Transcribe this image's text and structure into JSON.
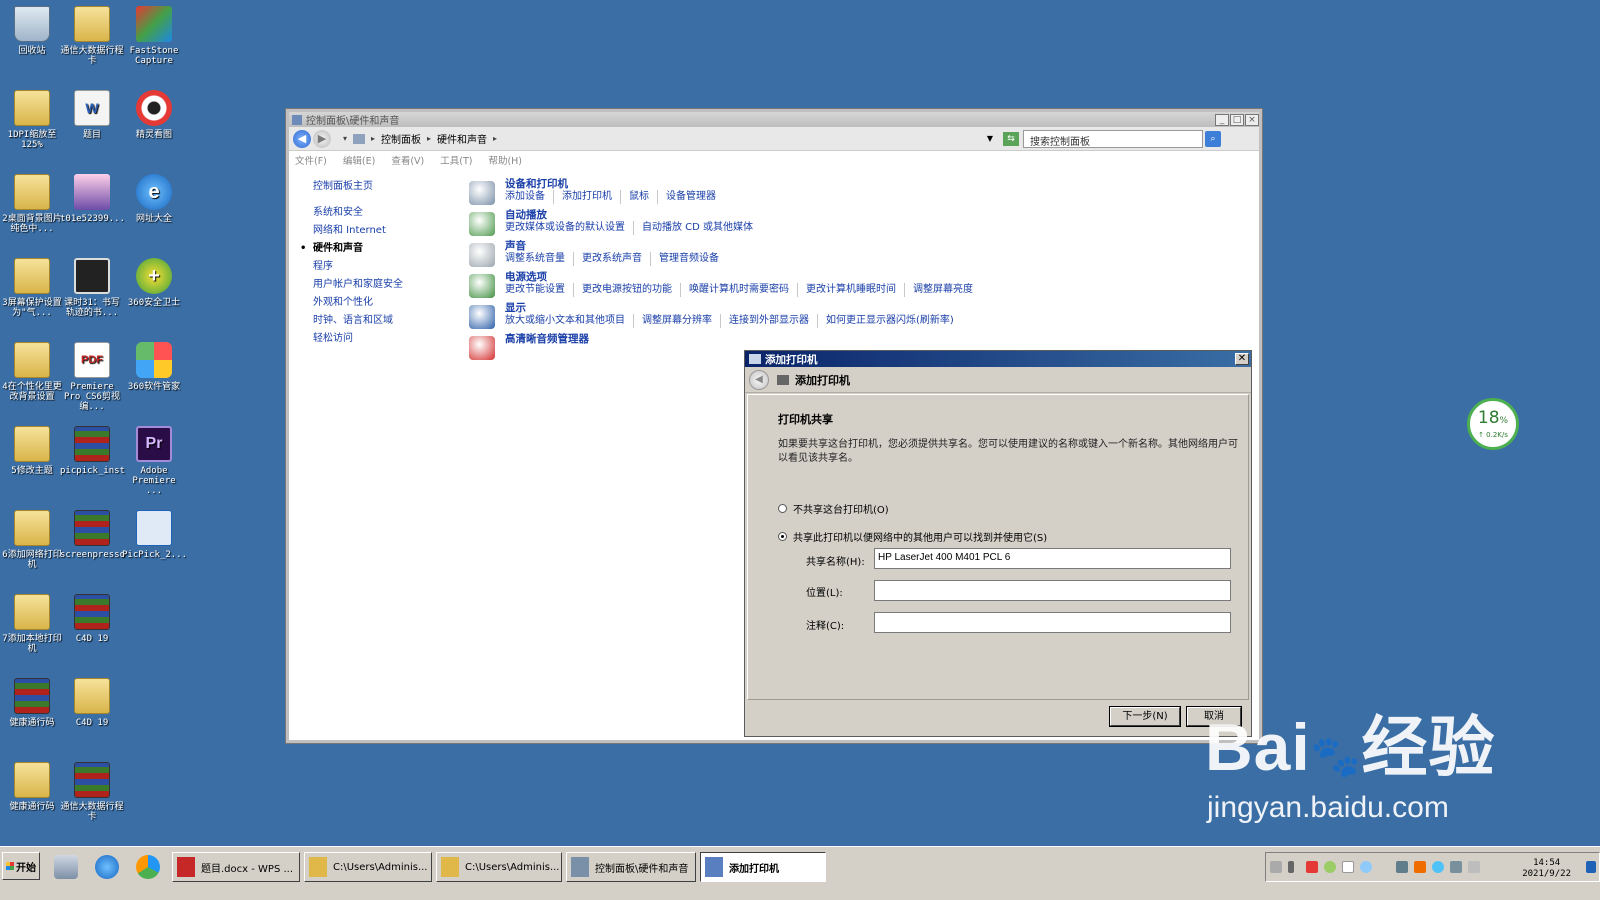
{
  "desktop": {
    "icons": [
      {
        "label": "回收站",
        "kind": "recycle"
      },
      {
        "label": "通信大数据行程卡",
        "kind": "folder"
      },
      {
        "label": "FastStone Capture",
        "kind": "app"
      },
      {
        "label": "1DPI缩放至125%",
        "kind": "folder"
      },
      {
        "label": "题目",
        "kind": "doc"
      },
      {
        "label": "精灵看图",
        "kind": "eye"
      },
      {
        "label": "2桌面背景图片纯色中...",
        "kind": "folder"
      },
      {
        "label": "t01e52399...",
        "kind": "pic"
      },
      {
        "label": "网址大全",
        "kind": "ie"
      },
      {
        "label": "3屏幕保护设置为\"气...",
        "kind": "folder"
      },
      {
        "label": "课时31：书写轨迹的书...",
        "kind": "dark"
      },
      {
        "label": "360安全卫士",
        "kind": "green"
      },
      {
        "label": "4在个性化里更改背景设置",
        "kind": "folder"
      },
      {
        "label": "Premiere Pro CS6剪视编...",
        "kind": "pdf"
      },
      {
        "label": "360软件管家",
        "kind": "color4"
      },
      {
        "label": "5修改主题",
        "kind": "folder"
      },
      {
        "label": "picpick_inst",
        "kind": "rar"
      },
      {
        "label": "Adobe Premiere ...",
        "kind": "pr"
      },
      {
        "label": "6添加网络打印机",
        "kind": "folder"
      },
      {
        "label": "screenpresso",
        "kind": "rar"
      },
      {
        "label": "PicPick_2...",
        "kind": "screen"
      },
      {
        "label": "7添加本地打印机",
        "kind": "folder"
      },
      {
        "label": "C4D 19",
        "kind": "rar"
      },
      {
        "label": "C4D 19",
        "kind": "folder"
      },
      {
        "label": "健康通行码",
        "kind": "rar"
      },
      {
        "label": "健康通行码",
        "kind": "folder"
      },
      {
        "label": "通信大数据行程卡",
        "kind": "rar"
      }
    ],
    "glyphs": {
      "pdf": "PDF",
      "pr": "Pr",
      "ie": "e",
      "green": "+",
      "doc": "W"
    }
  },
  "control_panel": {
    "title": "控制面板\\硬件和声音",
    "breadcrumb": [
      "控制面板",
      "硬件和声音"
    ],
    "search_placeholder": "搜索控制面板",
    "menu": [
      "文件(F)",
      "编辑(E)",
      "查看(V)",
      "工具(T)",
      "帮助(H)"
    ],
    "left_nav": {
      "home": "控制面板主页",
      "items": [
        "系统和安全",
        "网络和 Internet",
        "硬件和声音",
        "程序",
        "用户帐户和家庭安全",
        "外观和个性化",
        "时钟、语言和区域",
        "轻松访问"
      ],
      "current_index": 2
    },
    "categories": [
      {
        "title": "设备和打印机",
        "links": [
          "添加设备",
          "添加打印机",
          "鼠标",
          "设备管理器"
        ],
        "icon": "printer-icon",
        "color": "#7a8fa8"
      },
      {
        "title": "自动播放",
        "links": [
          "更改媒体或设备的默认设置",
          "自动播放 CD 或其他媒体"
        ],
        "icon": "autoplay-icon",
        "color": "#4e9a4e"
      },
      {
        "title": "声音",
        "links": [
          "调整系统音量",
          "更改系统声音",
          "管理音频设备"
        ],
        "icon": "speaker-icon",
        "color": "#9aa4ad"
      },
      {
        "title": "电源选项",
        "links": [
          "更改节能设置",
          "更改电源按钮的功能",
          "唤醒计算机时需要密码",
          "更改计算机睡眠时间",
          "调整屏幕亮度"
        ],
        "icon": "power-icon",
        "color": "#3f8f3f"
      },
      {
        "title": "显示",
        "links": [
          "放大或缩小文本和其他项目",
          "调整屏幕分辨率",
          "连接到外部显示器",
          "如何更正显示器闪烁(刷新率)"
        ],
        "icon": "display-icon",
        "color": "#2c5fa8"
      },
      {
        "title": "高清晰音频管理器",
        "links": [],
        "icon": "audio-manager-icon",
        "color": "#d32f2f"
      }
    ]
  },
  "dialog": {
    "title": "添加打印机",
    "header": "添加打印机",
    "section_title": "打印机共享",
    "description": "如果要共享这台打印机，您必须提供共享名。您可以使用建议的名称或键入一个新名称。其他网络用户可以看见该共享名。",
    "option_no_share": "不共享这台打印机(O)",
    "option_share": "共享此打印机以便网络中的其他用户可以找到并使用它(S)",
    "share_name_label": "共享名称(H):",
    "share_name_value": "HP LaserJet 400 M401 PCL 6",
    "location_label": "位置(L):",
    "location_value": "",
    "comment_label": "注释(C):",
    "comment_value": "",
    "next_label": "下一步(N)",
    "cancel_label": "取消",
    "selected_option": "share"
  },
  "taskbar": {
    "start_label": "开始",
    "tasks": [
      {
        "label": "题目.docx - WPS ...",
        "active": false,
        "color": "#c62828"
      },
      {
        "label": "C:\\Users\\Adminis...",
        "active": false,
        "color": "#e0b84a"
      },
      {
        "label": "C:\\Users\\Adminis...",
        "active": false,
        "color": "#e0b84a"
      },
      {
        "label": "控制面板\\硬件和声音",
        "active": false,
        "color": "#7a8fa8"
      },
      {
        "label": "添加打印机",
        "active": true,
        "color": "#5a7fc0"
      }
    ],
    "clock_time": "14:54",
    "clock_date": "2021/9/22"
  },
  "net_widget": {
    "percent": "18",
    "percent_unit": "%",
    "speed": "↑ 0.2K/s"
  },
  "watermark": {
    "brand": "Bai",
    "brand2": "经验",
    "url": "jingyan.baidu.com"
  }
}
